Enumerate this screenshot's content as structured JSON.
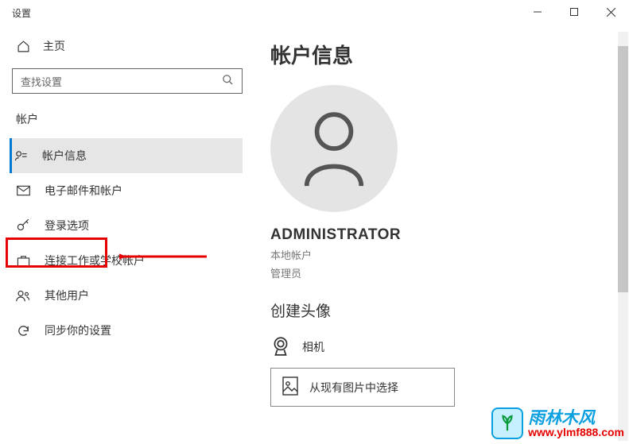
{
  "window": {
    "title": "设置"
  },
  "sidebar": {
    "home": "主页",
    "search_placeholder": "查找设置",
    "section": "帐户",
    "items": [
      {
        "label": "帐户信息"
      },
      {
        "label": "电子邮件和帐户"
      },
      {
        "label": "登录选项"
      },
      {
        "label": "连接工作或学校帐户"
      },
      {
        "label": "其他用户"
      },
      {
        "label": "同步你的设置"
      }
    ]
  },
  "main": {
    "title": "帐户信息",
    "user_name": "ADMINISTRATOR",
    "account_type": "本地帐户",
    "role": "管理员",
    "create_avatar": "创建头像",
    "camera": "相机",
    "browse": "从现有图片中选择"
  },
  "watermark": {
    "brand": "雨林木风",
    "url": "www.ylmf888.com"
  }
}
